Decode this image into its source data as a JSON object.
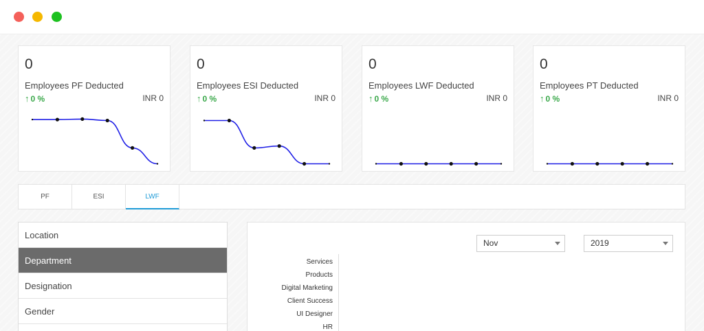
{
  "cards": [
    {
      "count": "0",
      "title": "Employees PF Deducted",
      "trend": "0 %",
      "amount": "INR 0",
      "sparkline": [
        0.97,
        0.97,
        0.98,
        0.95,
        0.38,
        0.05
      ]
    },
    {
      "count": "0",
      "title": "Employees ESI Deducted",
      "trend": "0 %",
      "amount": "INR 0",
      "sparkline": [
        0.95,
        0.95,
        0.38,
        0.42,
        0.05,
        0.05
      ]
    },
    {
      "count": "0",
      "title": "Employees LWF Deducted",
      "trend": "0 %",
      "amount": "INR 0",
      "sparkline": [
        0.05,
        0.05,
        0.05,
        0.05,
        0.05,
        0.05
      ]
    },
    {
      "count": "0",
      "title": "Employees PT Deducted",
      "trend": "0 %",
      "amount": "INR 0",
      "sparkline": [
        0.05,
        0.05,
        0.05,
        0.05,
        0.05,
        0.05
      ]
    }
  ],
  "tabs": [
    "PF",
    "ESI",
    "LWF"
  ],
  "active_tab": "LWF",
  "filters": [
    "Location",
    "Department",
    "Designation",
    "Gender"
  ],
  "active_filter": "Department",
  "month_select": "Nov",
  "year_select": "2019",
  "chart_data": {
    "type": "bar",
    "categories": [
      "Services",
      "Products",
      "Digital Marketing",
      "Client Success",
      "UI Designer",
      "HR"
    ],
    "values": []
  },
  "colors": {
    "accent": "#1e9bd7",
    "trend": "#3aa84a",
    "sparkline": "#1f1fe6",
    "active_filter_bg": "#6b6b6b"
  }
}
